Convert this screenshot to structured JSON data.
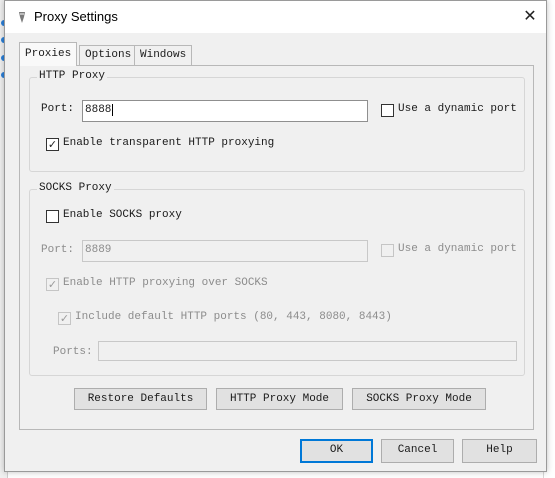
{
  "window": {
    "title": "Proxy Settings",
    "close_glyph": "✕"
  },
  "tabs": [
    {
      "label": "Proxies",
      "active": true
    },
    {
      "label": "Options",
      "active": false
    },
    {
      "label": "Windows",
      "active": false
    }
  ],
  "http_proxy": {
    "group_title": "HTTP Proxy",
    "port_label": "Port:",
    "port_value": "8888",
    "dynamic_port_label": "Use a dynamic port",
    "dynamic_port_checked": false,
    "transparent_label": "Enable transparent HTTP proxying",
    "transparent_checked": true
  },
  "socks_proxy": {
    "group_title": "SOCKS Proxy",
    "enable_label": "Enable SOCKS proxy",
    "enable_checked": false,
    "port_label": "Port:",
    "port_value": "8889",
    "dynamic_port_label": "Use a dynamic port",
    "http_over_socks_label": "Enable HTTP proxying over SOCKS",
    "http_over_socks_checked": true,
    "include_ports_label": "Include default HTTP ports (80, 443, 8080, 8443)",
    "include_ports_checked": true,
    "ports_label": "Ports:",
    "ports_value": ""
  },
  "buttons": {
    "restore_defaults": "Restore Defaults",
    "http_proxy_mode": "HTTP Proxy Mode",
    "socks_proxy_mode": "SOCKS Proxy Mode",
    "ok": "OK",
    "cancel": "Cancel",
    "help": "Help"
  },
  "colors": {
    "dialog_bg": "#f0f0f0",
    "default_button_border": "#0078d7",
    "disabled_text": "#8c8c8c"
  }
}
